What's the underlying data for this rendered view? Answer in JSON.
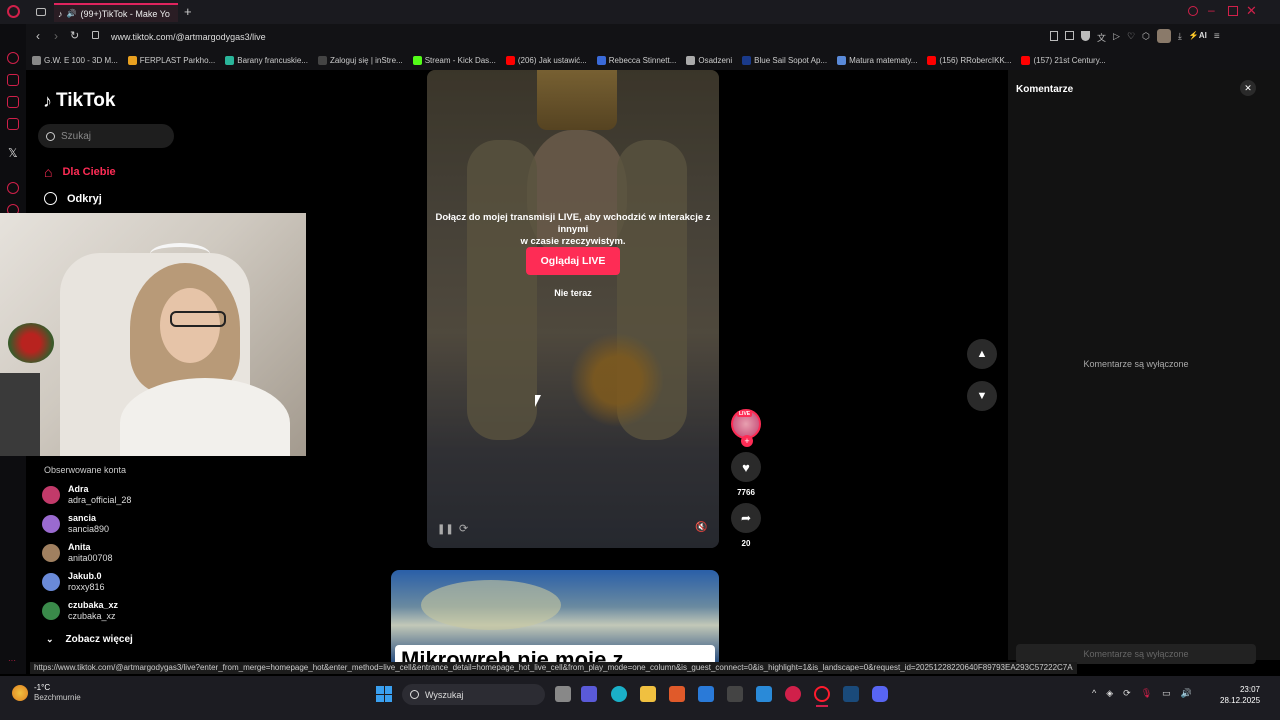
{
  "browser": {
    "tab_title": "(99+)TikTok - Make Yo",
    "url": "www.tiktok.com/@artmargodygas3/live",
    "bookmarks": [
      {
        "label": "G.W. E 100 - 3D M...",
        "color": "#888"
      },
      {
        "label": "FERPLAST Parkho...",
        "color": "#e8a020"
      },
      {
        "label": "Barany francuskie...",
        "color": "#2ab59a"
      },
      {
        "label": "Zaloguj się | inStre...",
        "color": "#444"
      },
      {
        "label": "Stream - Kick Das...",
        "color": "#53fc18"
      },
      {
        "label": "(206) Jak ustawić...",
        "color": "#ff0000"
      },
      {
        "label": "Rebecca Stinnett...",
        "color": "#3a6ad8"
      },
      {
        "label": "Osadzeni",
        "color": "#aaa"
      },
      {
        "label": "Blue Sail Sopot Ap...",
        "color": "#1a3a8a"
      },
      {
        "label": "Matura matematy...",
        "color": "#5a8ad8"
      },
      {
        "label": "(156) RRobercIKK...",
        "color": "#ff0000"
      },
      {
        "label": "(157) 21st Century...",
        "color": "#ff0000"
      }
    ]
  },
  "tiktok": {
    "logo": "TikTok",
    "search_placeholder": "Szukaj",
    "nav": {
      "for_you": "Dla Ciebie",
      "discover": "Odkryj"
    },
    "followed_title": "Obserwowane konta",
    "accounts": [
      {
        "name": "Adra",
        "user": "adra_official_28",
        "color": "#c23a6a"
      },
      {
        "name": "sancia",
        "user": "sancia890",
        "color": "#9a6ad0"
      },
      {
        "name": "Anita",
        "user": "anita00708",
        "color": "#a08060"
      },
      {
        "name": "Jakub.0",
        "user": "roxxy816",
        "color": "#6a8ad8"
      },
      {
        "name": "czubaka_xz",
        "user": "czubaka_xz",
        "color": "#3a8a4a"
      }
    ],
    "see_more": "Zobacz więcej"
  },
  "video": {
    "live_prompt_line1": "Dołącz do mojej transmisji LIVE, aby wchodzić w interakcje z innymi",
    "live_prompt_line2": "w czasie rzeczywistym.",
    "watch_button": "Oglądaj LIVE",
    "not_now": "Nie teraz",
    "live_badge": "LIVE",
    "likes": "7766",
    "shares": "20",
    "next_video_text": "Mikrowreh nie moje z"
  },
  "comments": {
    "title": "Komentarze",
    "disabled": "Komentarze są wyłączone",
    "input_disabled": "Komentarze są wyłączone"
  },
  "status_url": "https://www.tiktok.com/@artmargodygas3/live?enter_from_merge=homepage_hot&enter_method=live_cell&entrance_detail=homepage_hot_live_cell&from_play_mode=one_column&is_guest_connect=0&is_highlight=1&is_landscape=0&request_id=20251228220640F89793EA293C57222C7A",
  "taskbar": {
    "temp": "-1°C",
    "weather": "Bezchmurnie",
    "search": "Wyszukaj",
    "time": "23:07",
    "date": "28.12.2025"
  }
}
